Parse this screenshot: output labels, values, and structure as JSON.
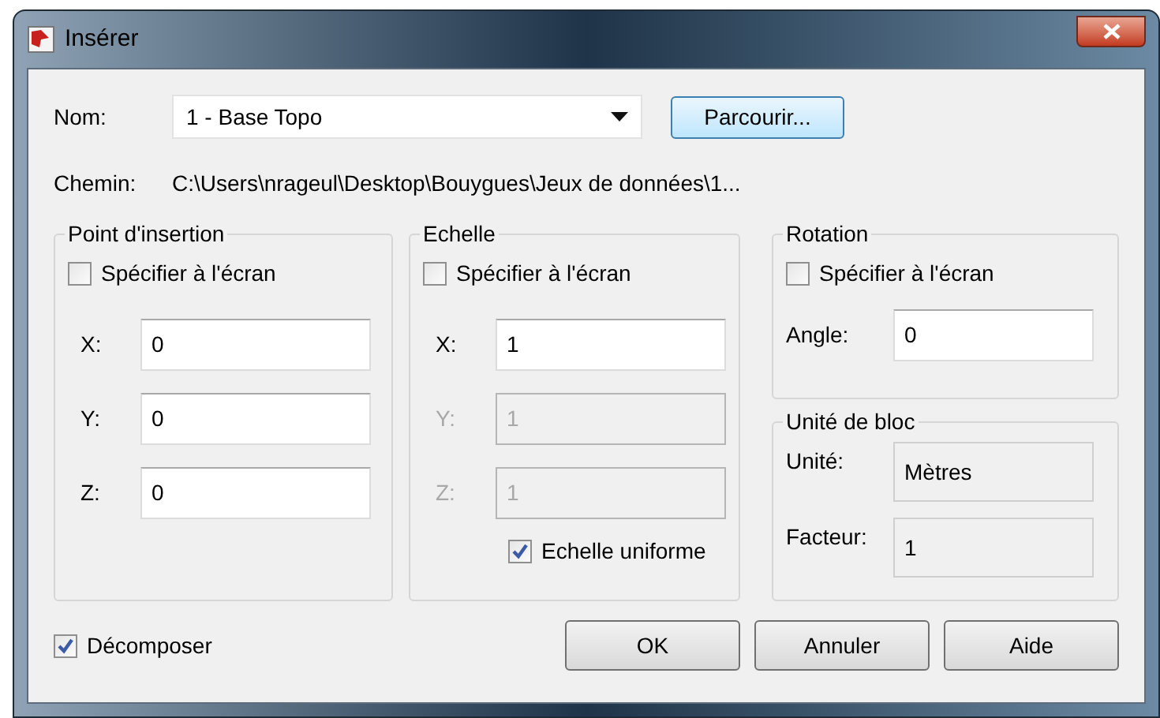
{
  "window": {
    "title": "Insérer"
  },
  "name_field": {
    "label": "Nom:",
    "value": "1 - Base Topo"
  },
  "browse_button": "Parcourir...",
  "path": {
    "label": "Chemin:",
    "value": "C:\\Users\\nrageul\\Desktop\\Bouygues\\Jeux de données\\1..."
  },
  "insertion_point": {
    "title": "Point d'insertion",
    "specify": {
      "label": "Spécifier à l'écran",
      "checked": false
    },
    "fields": [
      {
        "label": "X:",
        "value": "0",
        "disabled": false
      },
      {
        "label": "Y:",
        "value": "0",
        "disabled": false
      },
      {
        "label": "Z:",
        "value": "0",
        "disabled": false
      }
    ]
  },
  "scale": {
    "title": "Echelle",
    "specify": {
      "label": "Spécifier à l'écran",
      "checked": false
    },
    "fields": [
      {
        "label": "X:",
        "value": "1",
        "disabled": false
      },
      {
        "label": "Y:",
        "value": "1",
        "disabled": true
      },
      {
        "label": "Z:",
        "value": "1",
        "disabled": true
      }
    ],
    "uniform": {
      "label": "Echelle uniforme",
      "checked": true
    }
  },
  "rotation": {
    "title": "Rotation",
    "specify": {
      "label": "Spécifier à l'écran",
      "checked": false
    },
    "angle": {
      "label": "Angle:",
      "value": "0"
    }
  },
  "block_unit": {
    "title": "Unité de bloc",
    "fields": [
      {
        "label": "Unité:",
        "value": "Mètres"
      },
      {
        "label": "Facteur:",
        "value": "1"
      }
    ]
  },
  "explode": {
    "label": "Décomposer",
    "checked": true
  },
  "buttons": [
    {
      "label": "OK"
    },
    {
      "label": "Annuler"
    },
    {
      "label": "Aide"
    }
  ]
}
